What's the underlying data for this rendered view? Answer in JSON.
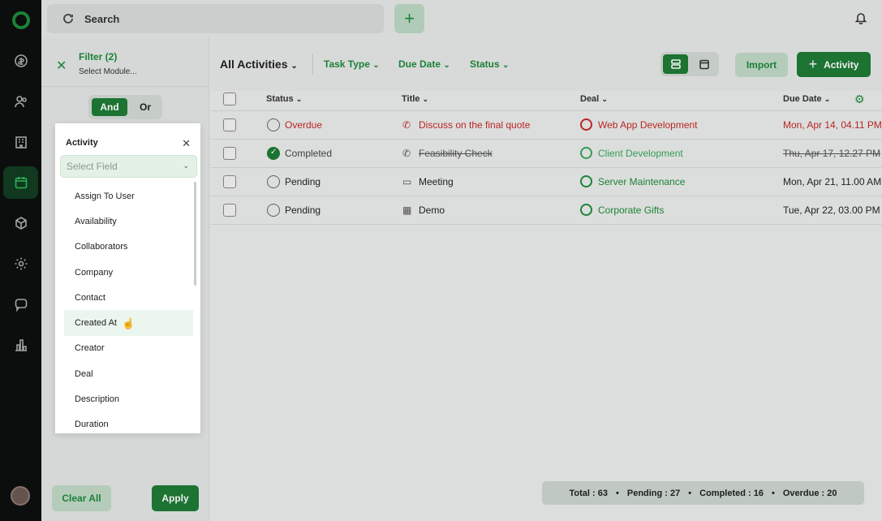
{
  "topbar": {
    "search_label": "Search"
  },
  "filter": {
    "title": "Filter (2)",
    "subtitle": "Select Module...",
    "and_label": "And",
    "or_label": "Or",
    "clear_all": "Clear All",
    "apply": "Apply"
  },
  "popup": {
    "title": "Activity",
    "select_placeholder": "Select Field",
    "items": [
      "Assign To User",
      "Availability",
      "Collaborators",
      "Company",
      "Contact",
      "Created At",
      "Creator",
      "Deal",
      "Description",
      "Duration"
    ],
    "hovered_index": 5
  },
  "toolbar": {
    "title": "All Activities",
    "filters": [
      "Task Type",
      "Due Date",
      "Status"
    ],
    "import": "Import",
    "activity": "Activity"
  },
  "table": {
    "headers": {
      "status": "Status",
      "title": "Title",
      "deal": "Deal",
      "due": "Due Date"
    },
    "rows": [
      {
        "status": "Overdue",
        "title": "Discuss on the final quote",
        "title_icon": "phone-icon",
        "deal": "Web App Development",
        "due": "Mon, Apr 14, 04.11 PM"
      },
      {
        "status": "Completed",
        "title": "Feasibility Check",
        "title_icon": "phone-icon",
        "deal": "Client Development",
        "due": "Thu, Apr 17, 12.27 PM"
      },
      {
        "status": "Pending",
        "title": "Meeting",
        "title_icon": "video-icon",
        "deal": "Server Maintenance",
        "due": "Mon, Apr 21, 11.00 AM"
      },
      {
        "status": "Pending",
        "title": "Demo",
        "title_icon": "calendar-icon",
        "deal": "Corporate Gifts",
        "due": "Tue, Apr 22, 03.00 PM"
      }
    ]
  },
  "stats": {
    "total": "Total : 63",
    "pending": "Pending : 27",
    "completed": "Completed : 16",
    "overdue": "Overdue : 20"
  },
  "colors": {
    "brand": "#1e7b36",
    "overdue": "#c62828"
  }
}
